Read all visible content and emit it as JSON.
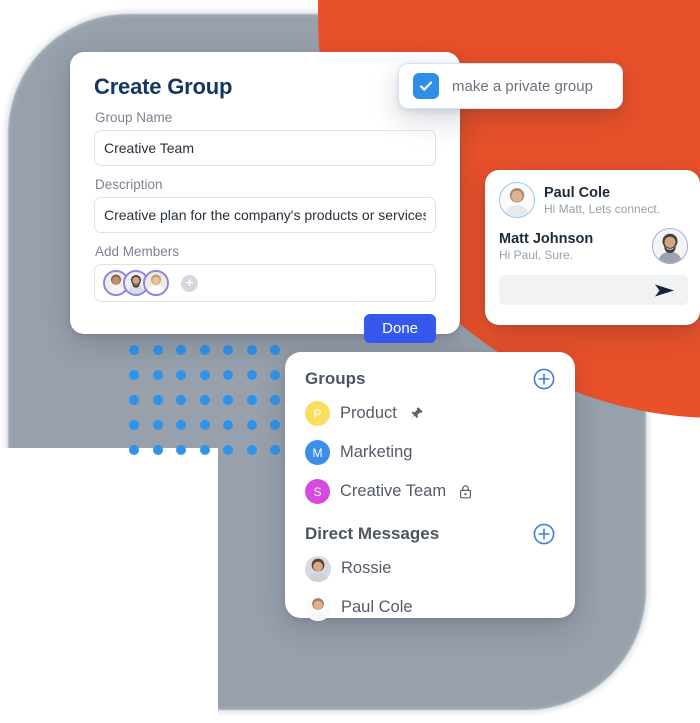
{
  "theme": {
    "orange": "#e8512a",
    "grey_plate": "#97a0ab",
    "dot_blue": "#2f93ea",
    "accent_blue": "#3558ed",
    "checkbox_blue": "#2f8fe8",
    "title_navy": "#153862"
  },
  "background": {
    "dot_grid_rows": 5,
    "dot_grid_cols": 7
  },
  "create_group_card": {
    "title": "Create Group",
    "group_name": {
      "label": "Group Name",
      "value": "Creative Team",
      "placeholder": "Group Name"
    },
    "description": {
      "label": "Description",
      "value": "Creative plan for the company's products or services",
      "placeholder": "Description"
    },
    "add_members": {
      "label": "Add Members",
      "member_count": 3,
      "add_icon": "plus-icon"
    },
    "done_label": "Done"
  },
  "private_group_pill": {
    "label": "make a private group",
    "checked": true,
    "icon": "check-icon"
  },
  "chat_card": {
    "messages": [
      {
        "name": "Paul Cole",
        "text": "Hi Matt, Lets connect.",
        "side": "left"
      },
      {
        "name": "Matt Johnson",
        "text": "Hi Paul, Sure.",
        "side": "right"
      }
    ],
    "input_placeholder": "",
    "send_icon": "send-icon"
  },
  "groups_panel": {
    "groups": {
      "title": "Groups",
      "add_icon": "plus-circle-icon",
      "items": [
        {
          "initial": "P",
          "label": "Product",
          "color": "#fade5f",
          "badge_icon": "pin-icon"
        },
        {
          "initial": "M",
          "label": "Marketing",
          "color": "#3b8eea",
          "badge_icon": ""
        },
        {
          "initial": "S",
          "label": "Creative Team",
          "color": "#d64ae0",
          "badge_icon": "lock-icon"
        }
      ]
    },
    "direct_messages": {
      "title": "Direct Messages",
      "add_icon": "plus-circle-icon",
      "items": [
        {
          "label": "Rossie"
        },
        {
          "label": "Paul Cole"
        }
      ]
    }
  }
}
